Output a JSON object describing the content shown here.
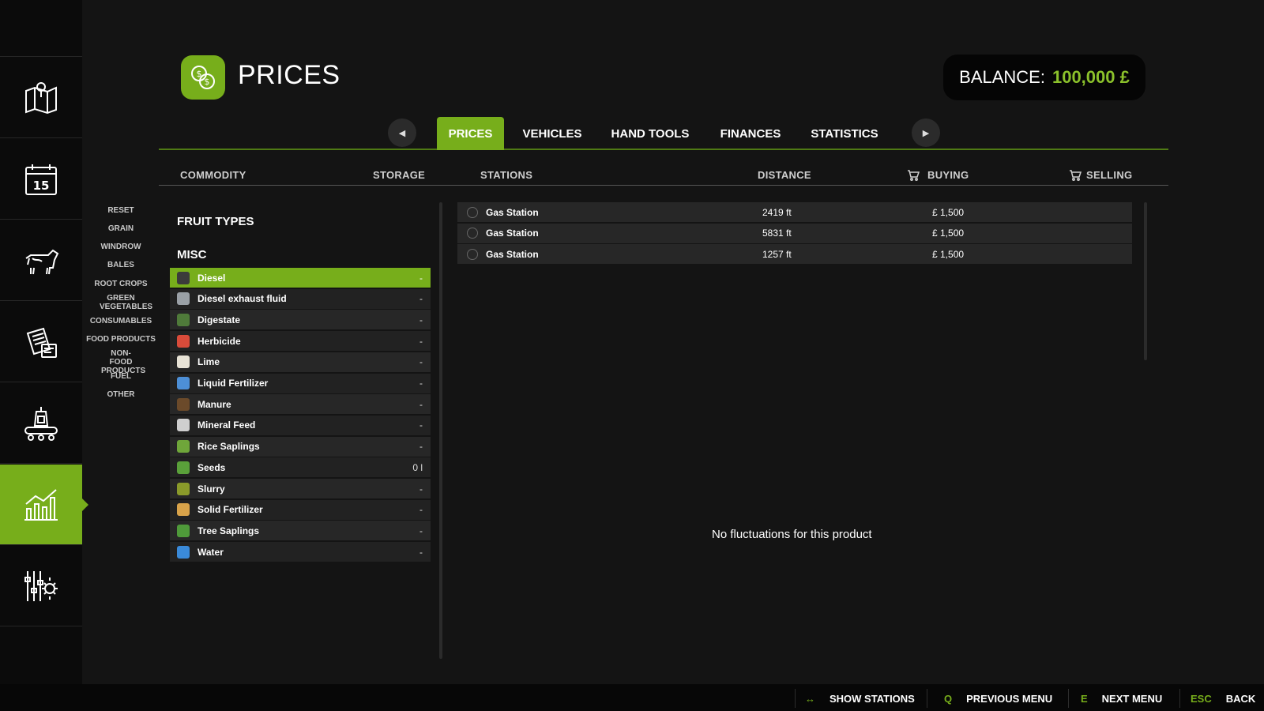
{
  "header": {
    "title": "PRICES",
    "balance_label": "BALANCE:",
    "balance_value": "100,000 £"
  },
  "tabs": [
    {
      "label": "PRICES",
      "active": true
    },
    {
      "label": "VEHICLES",
      "active": false
    },
    {
      "label": "HAND TOOLS",
      "active": false
    },
    {
      "label": "FINANCES",
      "active": false
    },
    {
      "label": "STATISTICS",
      "active": false
    }
  ],
  "columns": {
    "commodity": "COMMODITY",
    "storage": "STORAGE",
    "stations": "STATIONS",
    "distance": "DISTANCE",
    "buying": "BUYING",
    "selling": "SELLING"
  },
  "categories": [
    "RESET",
    "GRAIN",
    "WINDROW",
    "BALES",
    "ROOT CROPS",
    "GREEN VEGETABLES",
    "CONSUMABLES",
    "FOOD PRODUCTS",
    "NON-FOOD PRODUCTS",
    "FUEL",
    "OTHER"
  ],
  "sections": {
    "fruit_types": "FRUIT TYPES",
    "misc": "MISC"
  },
  "commodities": [
    {
      "name": "Diesel",
      "storage": "-",
      "selected": true,
      "icon_color": "#3b3b3b"
    },
    {
      "name": "Diesel exhaust fluid",
      "storage": "-",
      "icon_color": "#9aa0a6"
    },
    {
      "name": "Digestate",
      "storage": "-",
      "icon_color": "#4f7a3a"
    },
    {
      "name": "Herbicide",
      "storage": "-",
      "icon_color": "#d94b3a"
    },
    {
      "name": "Lime",
      "storage": "-",
      "icon_color": "#e8e3d6"
    },
    {
      "name": "Liquid Fertilizer",
      "storage": "-",
      "icon_color": "#4d8fd6"
    },
    {
      "name": "Manure",
      "storage": "-",
      "icon_color": "#6b4a2a"
    },
    {
      "name": "Mineral Feed",
      "storage": "-",
      "icon_color": "#cfcfcf"
    },
    {
      "name": "Rice Saplings",
      "storage": "-",
      "icon_color": "#6fa63a"
    },
    {
      "name": "Seeds",
      "storage": "0 l",
      "icon_color": "#5aa03a"
    },
    {
      "name": "Slurry",
      "storage": "-",
      "icon_color": "#8a9a2a"
    },
    {
      "name": "Solid Fertilizer",
      "storage": "-",
      "icon_color": "#d9a34a"
    },
    {
      "name": "Tree Saplings",
      "storage": "-",
      "icon_color": "#4f9a3a"
    },
    {
      "name": "Water",
      "storage": "-",
      "icon_color": "#3a8ad9"
    }
  ],
  "stations": [
    {
      "name": "Gas Station",
      "distance": "2419 ft",
      "buying": "£ 1,500",
      "selling": ""
    },
    {
      "name": "Gas Station",
      "distance": "5831 ft",
      "buying": "£ 1,500",
      "selling": ""
    },
    {
      "name": "Gas Station",
      "distance": "1257 ft",
      "buying": "£ 1,500",
      "selling": ""
    }
  ],
  "fluctuation_message": "No fluctuations for this product",
  "footer": [
    {
      "key": "↔",
      "label": "SHOW STATIONS"
    },
    {
      "key": "Q",
      "label": "PREVIOUS MENU"
    },
    {
      "key": "E",
      "label": "NEXT MENU"
    },
    {
      "key": "ESC",
      "label": "BACK"
    }
  ],
  "colors": {
    "accent": "#77ae1b",
    "balance": "#8bc12b",
    "background": "#141414"
  },
  "nav_icons": [
    "map-icon",
    "calendar-icon",
    "animals-icon",
    "contracts-icon",
    "production-icon",
    "prices-chart-icon",
    "settings-icon"
  ]
}
